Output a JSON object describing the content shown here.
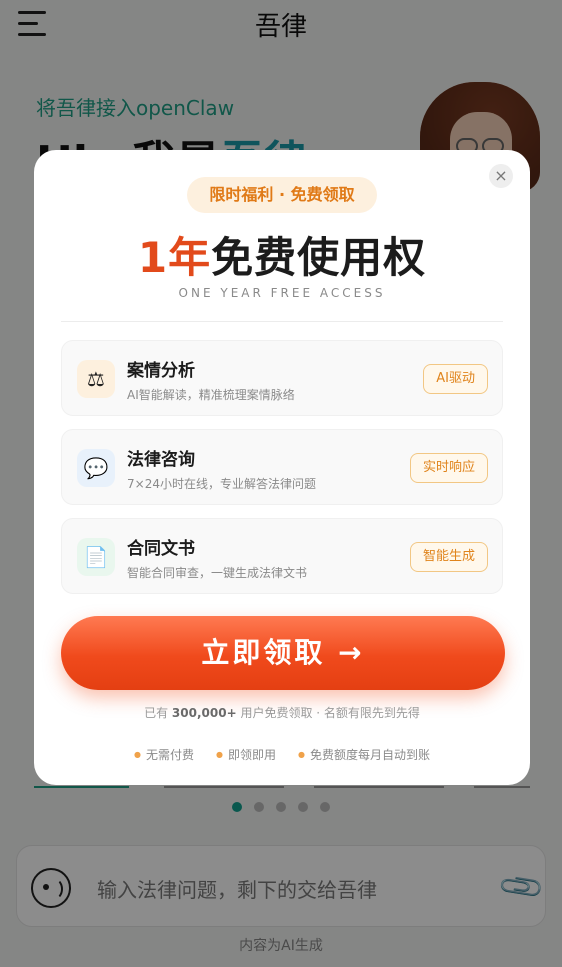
{
  "app": {
    "title": "吾律",
    "hero_subtitle": "将吾律接入openClaw",
    "hero_title_prefix": "Hi，我是",
    "hero_title_brand": "吾律",
    "input_placeholder": "输入法律问题，剩下的交给吾律",
    "ai_note": "内容为AI生成"
  },
  "carousel": {
    "total": 5,
    "active": 1
  },
  "modal": {
    "close_label": "×",
    "badge": "限时福利 · 免费领取",
    "headline_accent": "1年",
    "headline_rest": "免费使用权",
    "tagline": "ONE YEAR FREE ACCESS",
    "features": [
      {
        "icon": "⚖",
        "title": "案情分析",
        "desc": "AI智能解读，精准梳理案情脉络",
        "tag": "AI驱动",
        "icon_bg": "#fdf0de"
      },
      {
        "icon": "💬",
        "title": "法律咨询",
        "desc": "7×24小时在线，专业解答法律问题",
        "tag": "实时响应",
        "icon_bg": "#e8f1fb"
      },
      {
        "icon": "📄",
        "title": "合同文书",
        "desc": "智能合同审查，一键生成法律文书",
        "tag": "智能生成",
        "icon_bg": "#e9f7ee"
      }
    ],
    "cta_label": "立即领取 →",
    "claim_prefix": "已有",
    "claim_count": "300,000+",
    "claim_suffix": "用户免费领取 · 名额有限先到先得",
    "perks": [
      "无需付费",
      "即领即用",
      "免费额度每月自动到账"
    ]
  },
  "colors": {
    "brand_green": "#1f9e86",
    "accent_orange": "#e24a1b",
    "tag_orange": "#e0841c"
  }
}
